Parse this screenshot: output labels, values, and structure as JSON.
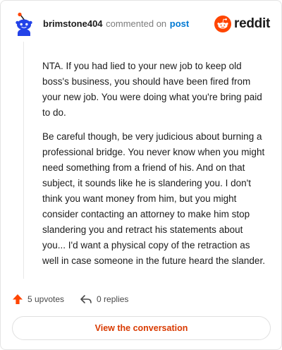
{
  "comment": {
    "author": "brimstone404",
    "action_text": "commented on",
    "target_link": "post",
    "brand": "reddit",
    "paragraphs": [
      "NTA. If you had lied to your new job to keep old boss's business, you should have been fired from your new job. You were doing what you're bring paid to do.",
      "Be careful though, be very judicious about burning a professional bridge. You never know when you might need something from a friend of his. And on that subject, it sounds like he is slandering you. I don't think you want money from him, but you might consider contacting an attorney to make him stop slandering you and retract his statements about you... I'd want a physical copy of the retraction as well in case someone in the future heard the slander."
    ]
  },
  "footer": {
    "upvotes_label": "5 upvotes",
    "replies_label": "0 replies",
    "view_button": "View the conversation"
  },
  "colors": {
    "brand_orange": "#ff4500",
    "link_blue": "#0079d3",
    "button_text": "#d93a00",
    "avatar_blue": "#2342e8"
  },
  "icons": [
    "snoo-avatar-icon",
    "reddit-logo-icon",
    "upvote-arrow-icon",
    "reply-arrow-icon"
  ]
}
